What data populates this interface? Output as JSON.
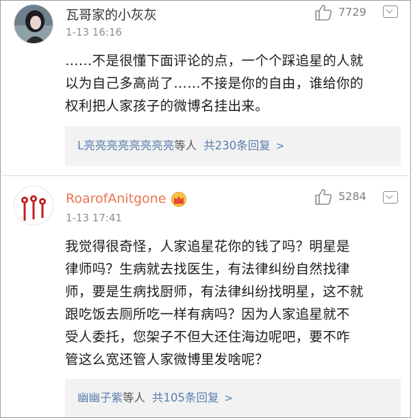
{
  "comments": [
    {
      "username": "瓦哥家的小灰灰",
      "time": "1-13 16:16",
      "likes": "7729",
      "text_lines": [
        "……不是很懂下面评论的点，一个个踩追星的人就",
        "以为自己多高尚了……不接是你的自由，谁给你的",
        "权利把人家孩子的微博名挂出来。"
      ],
      "reply_names": "L亮亮亮亮亮亮亮亮",
      "reply_suffix": "等人",
      "reply_total": "共230条回复",
      "reply_chevron": ">"
    },
    {
      "username": "RoarofAnitgone",
      "time": "1-13 17:41",
      "likes": "5284",
      "badge_icon": "crown-icon",
      "text_lines": [
        "我觉得很奇怪，人家追星花你的钱了吗？明星是",
        "律师吗？生病就去找医生，有法律纠纷自然找律",
        "师，要是生病找厨师，有法律纠纷找明星，这不就",
        "跟吃饭去厕所吃一样有病吗？因为人家追星就不",
        "受人委托，您架子不但大还住海边呢吧，要不咋",
        "管这么宽还管人家微博里发啥呢？"
      ],
      "reply_names": "幽幽子紫",
      "reply_suffix": "等人",
      "reply_total": "共105条回复",
      "reply_chevron": ">"
    }
  ],
  "colors": {
    "username_highlight": "#eb7350",
    "link_blue": "#5a7fb0",
    "reply_bg": "#f2f2f2"
  }
}
